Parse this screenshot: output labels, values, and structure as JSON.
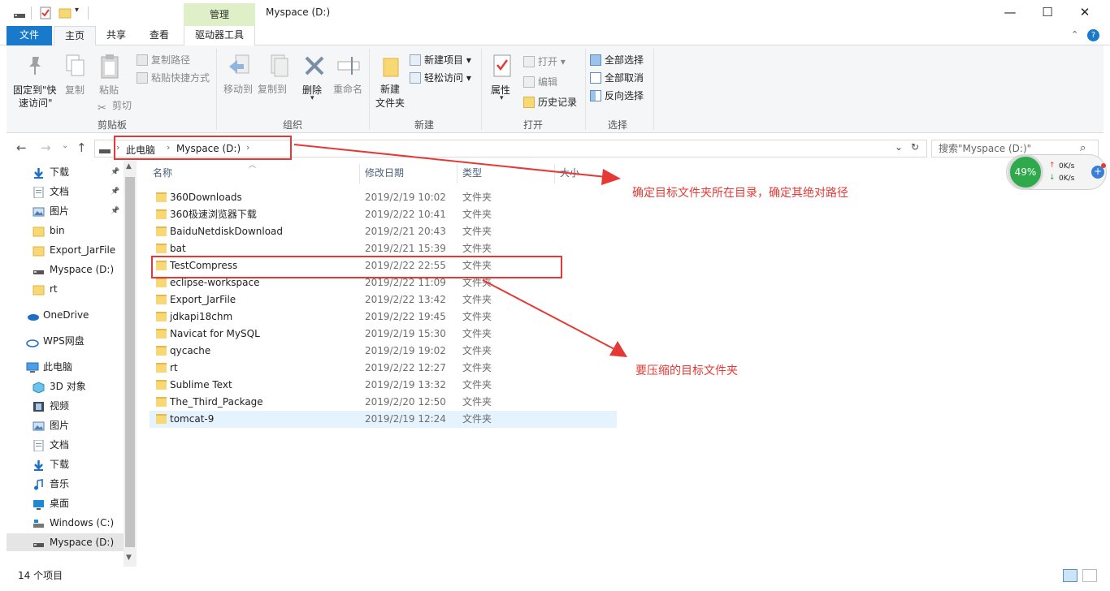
{
  "window": {
    "title": "Myspace (D:)",
    "context_tab_group": "管理",
    "controls": {
      "minimize": "—",
      "maximize": "☐",
      "close": "✕"
    }
  },
  "ribbon_tabs": {
    "file": "文件",
    "home": "主页",
    "share": "共享",
    "view": "查看",
    "drive_tools": "驱动器工具"
  },
  "ribbon": {
    "clipboard": {
      "label": "剪贴板",
      "pin": "固定到\"快\n速访问\"",
      "pin_l1": "固定到\"快",
      "pin_l2": "速访问\"",
      "copy": "复制",
      "paste": "粘贴",
      "copy_path": "复制路径",
      "paste_shortcut": "粘贴快捷方式",
      "cut": "剪切"
    },
    "organize": {
      "label": "组织",
      "move_to": "移动到",
      "copy_to": "复制到",
      "delete": "删除",
      "rename": "重命名"
    },
    "new": {
      "label": "新建",
      "new_folder_l1": "新建",
      "new_folder_l2": "文件夹",
      "new_item": "新建项目 ▾",
      "easy_access": "轻松访问 ▾"
    },
    "open": {
      "label": "打开",
      "properties": "属性",
      "open": "打开 ▾",
      "edit": "编辑",
      "history": "历史记录"
    },
    "select": {
      "label": "选择",
      "select_all": "全部选择",
      "select_none": "全部取消",
      "invert": "反向选择"
    }
  },
  "address": {
    "crumb_1": "此电脑",
    "crumb_2": "Myspace (D:)",
    "search_placeholder": "搜索\"Myspace (D:)\""
  },
  "nav_pane": {
    "quick": [
      {
        "label": "下载",
        "icon": "download-icon",
        "pinned": true
      },
      {
        "label": "文档",
        "icon": "document-icon",
        "pinned": true
      },
      {
        "label": "图片",
        "icon": "picture-icon",
        "pinned": true
      },
      {
        "label": "bin",
        "icon": "folder-icon",
        "pinned": false
      },
      {
        "label": "Export_JarFile",
        "icon": "folder-icon",
        "pinned": false
      },
      {
        "label": "Myspace (D:)",
        "icon": "drive-icon",
        "pinned": false
      },
      {
        "label": "rt",
        "icon": "folder-icon",
        "pinned": false
      }
    ],
    "onedrive": "OneDrive",
    "wps": "WPS网盘",
    "this_pc": "此电脑",
    "pc_items": [
      {
        "label": "3D 对象",
        "icon": "3d-objects-icon"
      },
      {
        "label": "视频",
        "icon": "video-icon"
      },
      {
        "label": "图片",
        "icon": "picture-icon"
      },
      {
        "label": "文档",
        "icon": "document-icon"
      },
      {
        "label": "下载",
        "icon": "download-icon"
      },
      {
        "label": "音乐",
        "icon": "music-icon"
      },
      {
        "label": "桌面",
        "icon": "desktop-icon"
      },
      {
        "label": "Windows (C:)",
        "icon": "drive-c-icon"
      },
      {
        "label": "Myspace (D:)",
        "icon": "drive-icon"
      }
    ]
  },
  "file_list": {
    "columns": {
      "name": "名称",
      "date": "修改日期",
      "type": "类型",
      "size": "大小"
    },
    "rows": [
      {
        "name": "360Downloads",
        "date": "2019/2/19 10:02",
        "type": "文件夹"
      },
      {
        "name": "360极速浏览器下载",
        "date": "2019/2/22 10:41",
        "type": "文件夹"
      },
      {
        "name": "BaiduNetdiskDownload",
        "date": "2019/2/21 20:43",
        "type": "文件夹"
      },
      {
        "name": "bat",
        "date": "2019/2/21 15:39",
        "type": "文件夹"
      },
      {
        "name": "TestCompress",
        "date": "2019/2/22 22:55",
        "type": "文件夹"
      },
      {
        "name": "eclipse-workspace",
        "date": "2019/2/22 11:09",
        "type": "文件夹"
      },
      {
        "name": "Export_JarFile",
        "date": "2019/2/22 13:42",
        "type": "文件夹"
      },
      {
        "name": "jdkapi18chm",
        "date": "2019/2/22 19:45",
        "type": "文件夹"
      },
      {
        "name": "Navicat for MySQL",
        "date": "2019/2/19 15:30",
        "type": "文件夹"
      },
      {
        "name": "qycache",
        "date": "2019/2/19 19:02",
        "type": "文件夹"
      },
      {
        "name": "rt",
        "date": "2019/2/22 12:27",
        "type": "文件夹"
      },
      {
        "name": "Sublime Text",
        "date": "2019/2/19 13:32",
        "type": "文件夹"
      },
      {
        "name": "The_Third_Package",
        "date": "2019/2/20 12:50",
        "type": "文件夹"
      },
      {
        "name": "tomcat-9",
        "date": "2019/2/19 12:24",
        "type": "文件夹"
      }
    ]
  },
  "status": {
    "count": "14 个项目"
  },
  "annotations": {
    "path_note": "确定目标文件夹所在目录，确定其绝对路径",
    "target_note": "要压缩的目标文件夹"
  },
  "speed_widget": {
    "percent": "49%",
    "up": "0K/s",
    "down": "0K/s"
  },
  "colors": {
    "accent": "#1979ca",
    "annotation": "#e53935",
    "folder": "#f8d775",
    "manage_tab": "#dff0c9"
  }
}
